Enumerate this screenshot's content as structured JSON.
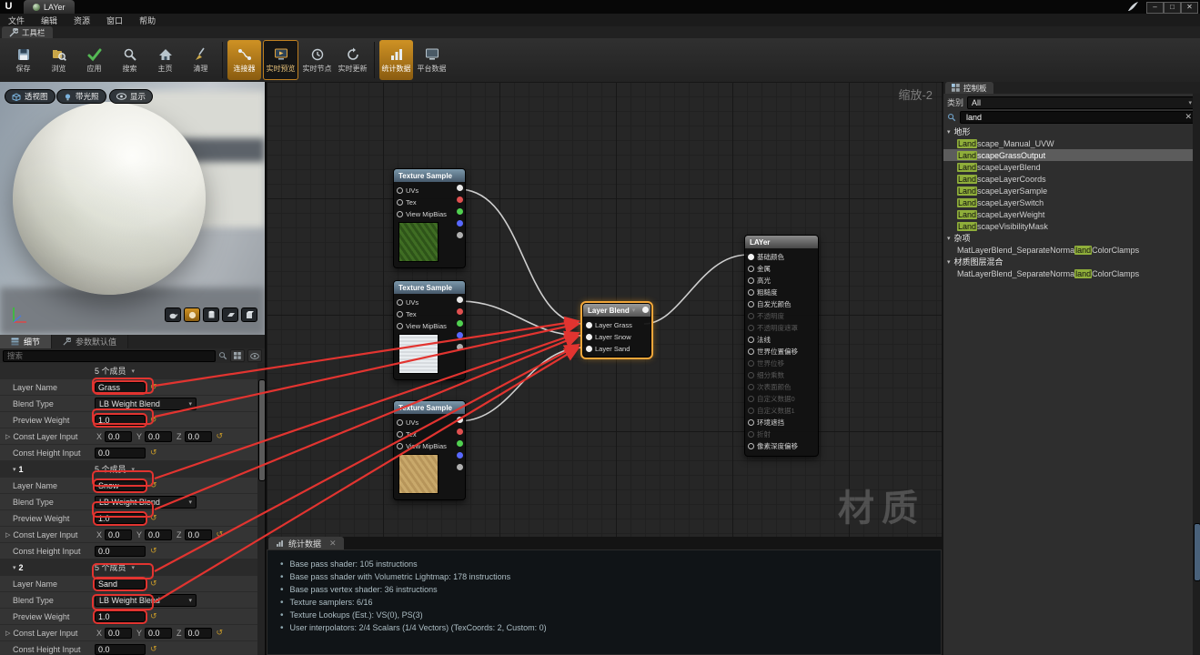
{
  "colors": {
    "accent_orange": "#cf9224",
    "selection_orange": "#f1a63a",
    "match_highlight": "#8fae3a",
    "annotation_red": "#e23430"
  },
  "window": {
    "logo": "U",
    "title": "LAYer",
    "menu": [
      "文件",
      "编辑",
      "资源",
      "窗口",
      "帮助"
    ],
    "controls": {
      "minimize": "–",
      "maximize": "□",
      "close": "✕"
    }
  },
  "toolbar": {
    "tab_label": "工具栏",
    "buttons": [
      {
        "label": "保存"
      },
      {
        "label": "浏览"
      },
      {
        "label": "应用"
      },
      {
        "label": "搜索"
      },
      {
        "label": "主页"
      },
      {
        "label": "清理"
      },
      {
        "label": "连接器",
        "active": "amber"
      },
      {
        "label": "实时预览",
        "active": "dark"
      },
      {
        "label": "实时节点"
      },
      {
        "label": "实时更新"
      },
      {
        "label": "统计数据",
        "active": "amber"
      },
      {
        "label": "平台数据"
      }
    ]
  },
  "viewport": {
    "buttons": [
      "透视图",
      "带光照",
      "显示"
    ],
    "shape_buttons": [
      "teapot",
      "sphere",
      "cylinder",
      "plane",
      "cube"
    ]
  },
  "details": {
    "tabs": [
      {
        "label": "细节"
      },
      {
        "label": "参数默认值"
      }
    ],
    "search_placeholder": "搜索",
    "row_labels": [
      "Layer Name",
      "Blend Type",
      "Preview Weight",
      "Const Layer Input",
      "Const Height Input"
    ],
    "axis_labels": [
      "X",
      "Y",
      "Z"
    ],
    "groups": [
      {
        "index": "",
        "members": "5 个成员",
        "layer_name": "Grass",
        "blend_type": "LB Weight Blend",
        "preview_weight": "1.0",
        "const_layer": [
          "0.0",
          "0.0",
          "0.0"
        ],
        "const_height": "0.0"
      },
      {
        "index": "1",
        "members": "5 个成员",
        "layer_name": "Snow",
        "blend_type": "LB Weight Blend",
        "preview_weight": "1.0",
        "const_layer": [
          "0.0",
          "0.0",
          "0.0"
        ],
        "const_height": "0.0"
      },
      {
        "index": "2",
        "members": "5 个成员",
        "layer_name": "Sand",
        "blend_type": "LB Weight Blend",
        "preview_weight": "1.0",
        "const_layer": [
          "0.0",
          "0.0",
          "0.0"
        ],
        "const_height": "0.0"
      }
    ]
  },
  "graph": {
    "zoom_label": "缩放-2",
    "watermark": "材质",
    "texture_nodes": [
      {
        "title": "Texture Sample",
        "inputs": [
          "UVs",
          "Tex",
          "View MipBias"
        ],
        "thumb": "grass"
      },
      {
        "title": "Texture Sample",
        "inputs": [
          "UVs",
          "Tex",
          "View MipBias"
        ],
        "thumb": "snow"
      },
      {
        "title": "Texture Sample",
        "inputs": [
          "UVs",
          "Tex",
          "View MipBias"
        ],
        "thumb": "sand"
      }
    ],
    "layer_blend": {
      "title": "Layer Blend",
      "inputs": [
        "Layer Grass",
        "Layer Snow",
        "Layer Sand"
      ]
    },
    "material_node": {
      "title": "LAYer",
      "pins": [
        {
          "label": "基础颜色",
          "enabled": true,
          "connected": true
        },
        {
          "label": "金属",
          "enabled": true
        },
        {
          "label": "高光",
          "enabled": true
        },
        {
          "label": "粗糙度",
          "enabled": true
        },
        {
          "label": "自发光颜色",
          "enabled": true
        },
        {
          "label": "不透明度",
          "enabled": false
        },
        {
          "label": "不透明度遮罩",
          "enabled": false
        },
        {
          "label": "法线",
          "enabled": true
        },
        {
          "label": "世界位置偏移",
          "enabled": true
        },
        {
          "label": "世界位移",
          "enabled": false
        },
        {
          "label": "细分乘数",
          "enabled": false
        },
        {
          "label": "次表面颜色",
          "enabled": false
        },
        {
          "label": "自定义数据0",
          "enabled": false
        },
        {
          "label": "自定义数据1",
          "enabled": false
        },
        {
          "label": "环境遮挡",
          "enabled": true
        },
        {
          "label": "折射",
          "enabled": false
        },
        {
          "label": "像素深度偏移",
          "enabled": true
        }
      ]
    }
  },
  "stats": {
    "tab_label": "统计数据",
    "lines": [
      "Base pass shader: 105 instructions",
      "Base pass shader with Volumetric Lightmap: 178 instructions",
      "Base pass vertex shader: 36 instructions",
      "Texture samplers: 6/16",
      "Texture Lookups (Est.): VS(0), PS(3)",
      "User interpolators: 2/4 Scalars (1/4 Vectors) (TexCoords: 2, Custom: 0)"
    ]
  },
  "palette": {
    "tab_label": "控制板",
    "category_label": "类别",
    "category_value": "All",
    "search_value": "land",
    "tree": [
      {
        "type": "header",
        "label": "地形"
      },
      {
        "type": "item",
        "pre": "",
        "match": "Land",
        "post": "scape_Manual_UVW"
      },
      {
        "type": "item",
        "pre": "",
        "match": "Land",
        "post": "scapeGrassOutput",
        "selected": true
      },
      {
        "type": "item",
        "pre": "",
        "match": "Land",
        "post": "scapeLayerBlend"
      },
      {
        "type": "item",
        "pre": "",
        "match": "Land",
        "post": "scapeLayerCoords"
      },
      {
        "type": "item",
        "pre": "",
        "match": "Land",
        "post": "scapeLayerSample"
      },
      {
        "type": "item",
        "pre": "",
        "match": "Land",
        "post": "scapeLayerSwitch"
      },
      {
        "type": "item",
        "pre": "",
        "match": "Land",
        "post": "scapeLayerWeight"
      },
      {
        "type": "item",
        "pre": "",
        "match": "Land",
        "post": "scapeVisibilityMask"
      },
      {
        "type": "header",
        "label": "杂项"
      },
      {
        "type": "item",
        "pre": "MatLayerBlend_SeparateNorma",
        "match": "land",
        "post": "ColorClamps"
      },
      {
        "type": "header",
        "label": "材质图层混合"
      },
      {
        "type": "item",
        "pre": "MatLayerBlend_SeparateNorma",
        "match": "land",
        "post": "ColorClamps"
      }
    ]
  }
}
